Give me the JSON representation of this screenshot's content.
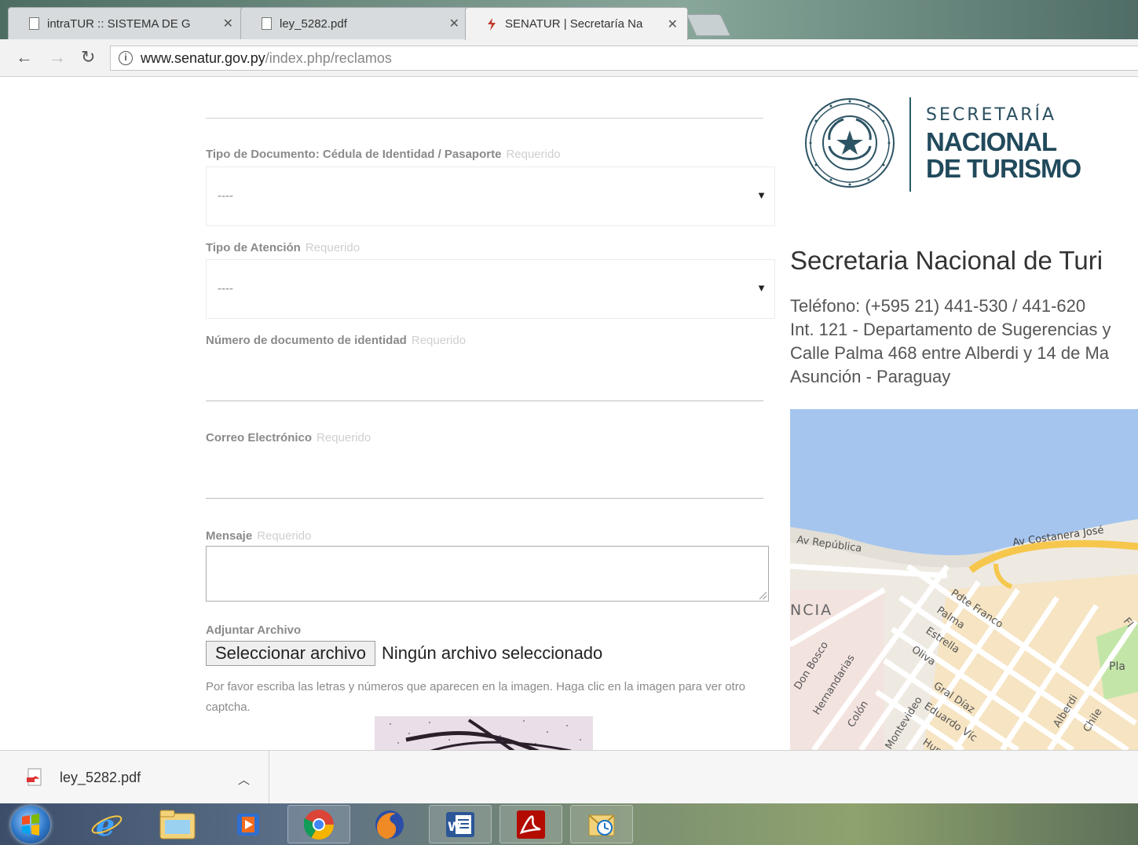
{
  "browser": {
    "tabs": [
      {
        "title": "intraTUR :: SISTEMA DE G",
        "active": false
      },
      {
        "title": "ley_5282.pdf",
        "active": false
      },
      {
        "title": "SENATUR | Secretaría Na",
        "active": true
      }
    ],
    "url_host": "www.senatur.gov.py",
    "url_path": "/index.php/reclamos"
  },
  "form": {
    "doc_type": {
      "label": "Tipo de Documento: Cédula de Identidad / Pasaporte",
      "required": "Requerido",
      "value": "----"
    },
    "attention_type": {
      "label": "Tipo de Atención",
      "required": "Requerido",
      "value": "----"
    },
    "doc_number": {
      "label": "Número de documento de identidad",
      "required": "Requerido"
    },
    "email": {
      "label": "Correo Electrónico",
      "required": "Requerido"
    },
    "message": {
      "label": "Mensaje",
      "required": "Requerido"
    },
    "attachment": {
      "label": "Adjuntar Archivo",
      "button": "Seleccionar archivo",
      "status": "Ningún archivo seleccionado"
    },
    "captcha_help": "Por favor escriba las letras y números que aparecen en la imagen. Haga clic en la imagen para ver otro captcha."
  },
  "sidebar": {
    "logo": {
      "line1": "SECRETARÍA",
      "line2": "NACIONAL",
      "line3": "DE TURISMO"
    },
    "title": "Secretaria Nacional de Turi",
    "contact": [
      "Teléfono: (+595 21) 441-530 / 441-620",
      "Int. 121 - Departamento de Sugerencias y",
      "Calle Palma 468 entre Alberdi y 14 de Ma",
      "Asunción - Paraguay"
    ],
    "map_labels": {
      "av_republica": "Av República",
      "av_costanera": "Av Costanera José",
      "district": "NCIA",
      "pdte_franco": "Pdte Franco",
      "palma": "Palma",
      "estrella": "Estrella",
      "oliva": "Oliva",
      "gral_diaz": "Gral Díaz",
      "eduardo_vic": "Eduardo Víc",
      "don_bosco": "Don Bosco",
      "hernandarias": "Hernandarias",
      "colon": "Colón",
      "montevideo": "Montevideo",
      "alberdi": "Alberdi",
      "chile": "Chile",
      "hum": "Hum",
      "pla": "Pla",
      "fl": "Fl"
    },
    "map_colors": {
      "water": "#a5c5ee",
      "land": "#eeeae2",
      "blocks": "#f6e4c2",
      "park": "#c3e6a8",
      "highway": "#f6c74c"
    }
  },
  "downloads": {
    "filename": "ley_5282.pdf"
  },
  "taskbar": {
    "apps": [
      "internet-explorer",
      "file-explorer",
      "media-player",
      "chrome",
      "firefox",
      "word",
      "acrobat",
      "outlook"
    ]
  }
}
